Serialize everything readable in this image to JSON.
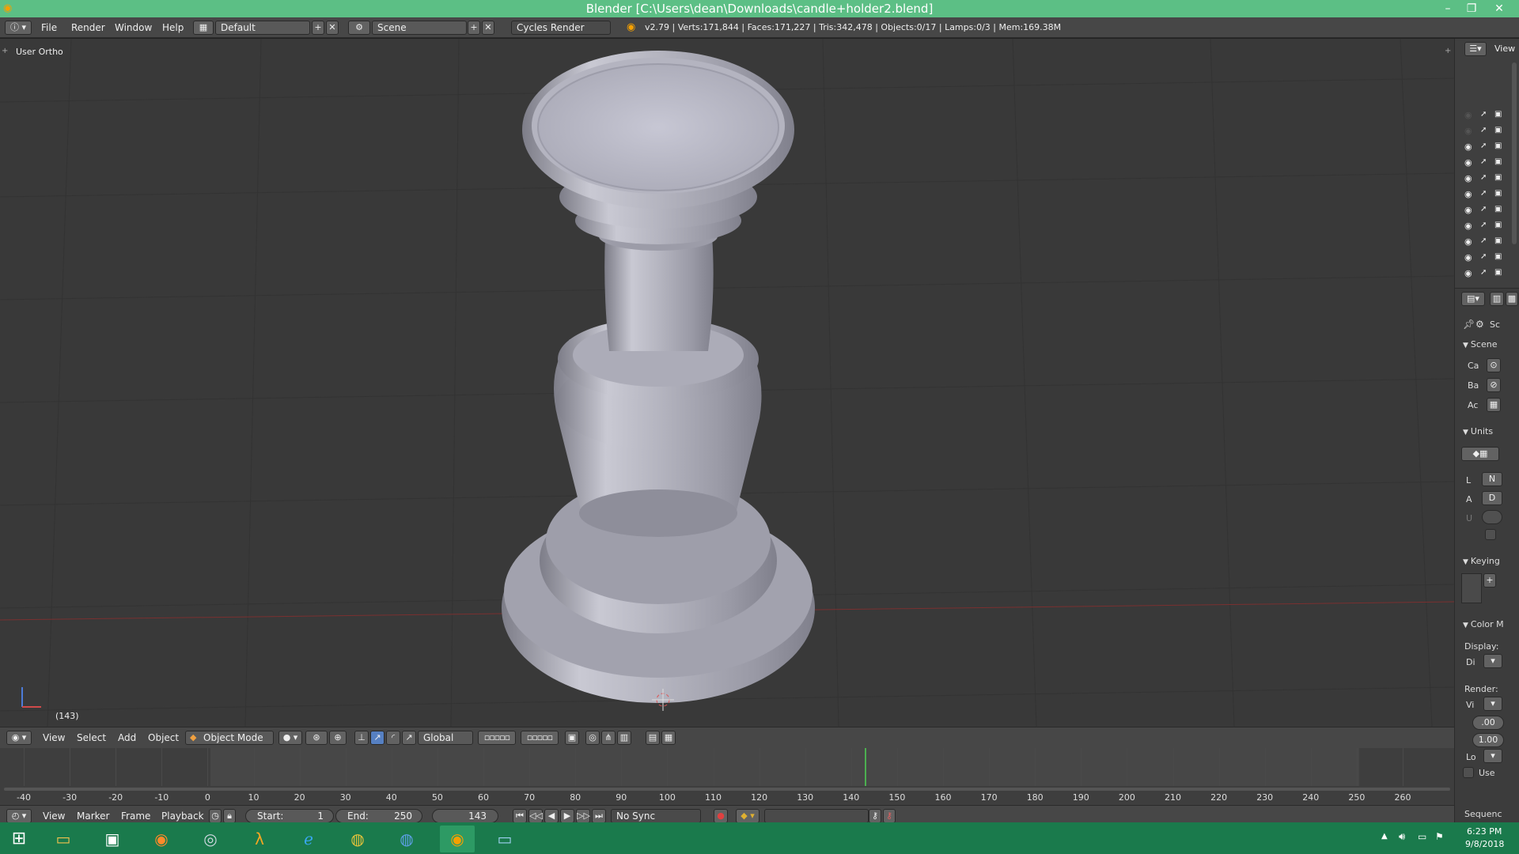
{
  "window": {
    "title": "Blender [C:\\Users\\dean\\Downloads\\candle+holder2.blend]",
    "minimize": "–",
    "maximize": "❐",
    "close": "✕"
  },
  "info_header": {
    "menus": [
      "File",
      "Render",
      "Window",
      "Help"
    ],
    "screen_layout": "Default",
    "scene": "Scene",
    "render_engine": "Cycles Render",
    "stats": "v2.79 | Verts:171,844 | Faces:171,227 | Tris:342,478 | Objects:0/17 | Lamps:0/3 | Mem:169.38M"
  },
  "viewport": {
    "view_label": "User Ortho",
    "frame_label": "(143)",
    "model": "candle holder"
  },
  "view3d_header": {
    "menus": [
      "View",
      "Select",
      "Add",
      "Object"
    ],
    "mode": "Object Mode",
    "orientation": "Global"
  },
  "timeline": {
    "ticks": [
      "-40",
      "-30",
      "-20",
      "-10",
      "0",
      "10",
      "20",
      "30",
      "40",
      "50",
      "60",
      "70",
      "80",
      "90",
      "100",
      "110",
      "120",
      "130",
      "140",
      "150",
      "160",
      "170",
      "180",
      "190",
      "200",
      "210",
      "220",
      "230",
      "240",
      "250",
      "260"
    ],
    "current_frame": 143,
    "menus": [
      "View",
      "Marker",
      "Frame",
      "Playback"
    ],
    "start_label": "Start:",
    "start_value": "1",
    "end_label": "End:",
    "end_value": "250",
    "frame_value": "143",
    "sync": "No Sync"
  },
  "outliner": {
    "view_label": "View"
  },
  "properties": {
    "tab_label": "Sc",
    "scene_panel": "Scene",
    "rows": [
      "Ca",
      "Ba",
      "Ac"
    ],
    "units_panel": "Units",
    "unit_l": "L",
    "unit_l_value": "N",
    "unit_a": "A",
    "unit_a_value": "D",
    "unit_u": "U",
    "keying_panel": "Keying",
    "color_panel": "Color M",
    "display_label": "Display:",
    "display_value": "Di",
    "render_label": "Render:",
    "render_value": "Vi",
    "exposure": ".00",
    "gamma": "1.00",
    "look": "Lo",
    "use_curves": "Use",
    "sequencer": "Sequenc"
  },
  "taskbar": {
    "time": "6:23 PM",
    "date": "9/8/2018"
  },
  "colors": {
    "titlebar": "#5cbf85",
    "viewport": "#393939",
    "frame_marker": "#4caf50",
    "taskbar": "#1a7a4c"
  }
}
